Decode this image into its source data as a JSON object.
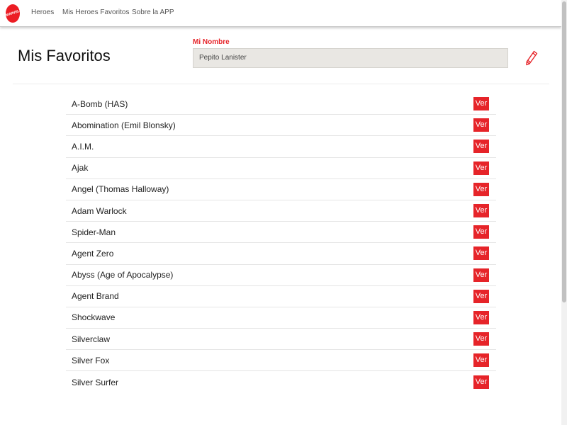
{
  "navbar": {
    "logo_text": "MARVEL",
    "links": [
      "Heroes",
      "Mis Heroes Favoritos",
      "Sobre la APP"
    ]
  },
  "header": {
    "title": "Mis Favoritos",
    "name_label": "Mi Nombre",
    "name_value": "Pepito Lanister",
    "edit_icon": "pencil-icon"
  },
  "heroes": [
    {
      "name": "A-Bomb (HAS)",
      "action": "Ver"
    },
    {
      "name": "Abomination (Emil Blonsky)",
      "action": "Ver"
    },
    {
      "name": "A.I.M.",
      "action": "Ver"
    },
    {
      "name": "Ajak",
      "action": "Ver"
    },
    {
      "name": "Angel (Thomas Halloway)",
      "action": "Ver"
    },
    {
      "name": "Adam Warlock",
      "action": "Ver"
    },
    {
      "name": "Spider-Man",
      "action": "Ver"
    },
    {
      "name": "Agent Zero",
      "action": "Ver"
    },
    {
      "name": "Abyss (Age of Apocalypse)",
      "action": "Ver"
    },
    {
      "name": "Agent Brand",
      "action": "Ver"
    },
    {
      "name": "Shockwave",
      "action": "Ver"
    },
    {
      "name": "Silverclaw",
      "action": "Ver"
    },
    {
      "name": "Silver Fox",
      "action": "Ver"
    },
    {
      "name": "Silver Surfer",
      "action": "Ver"
    }
  ],
  "colors": {
    "accent": "#e62429",
    "input_bg": "#e9e7e3"
  }
}
